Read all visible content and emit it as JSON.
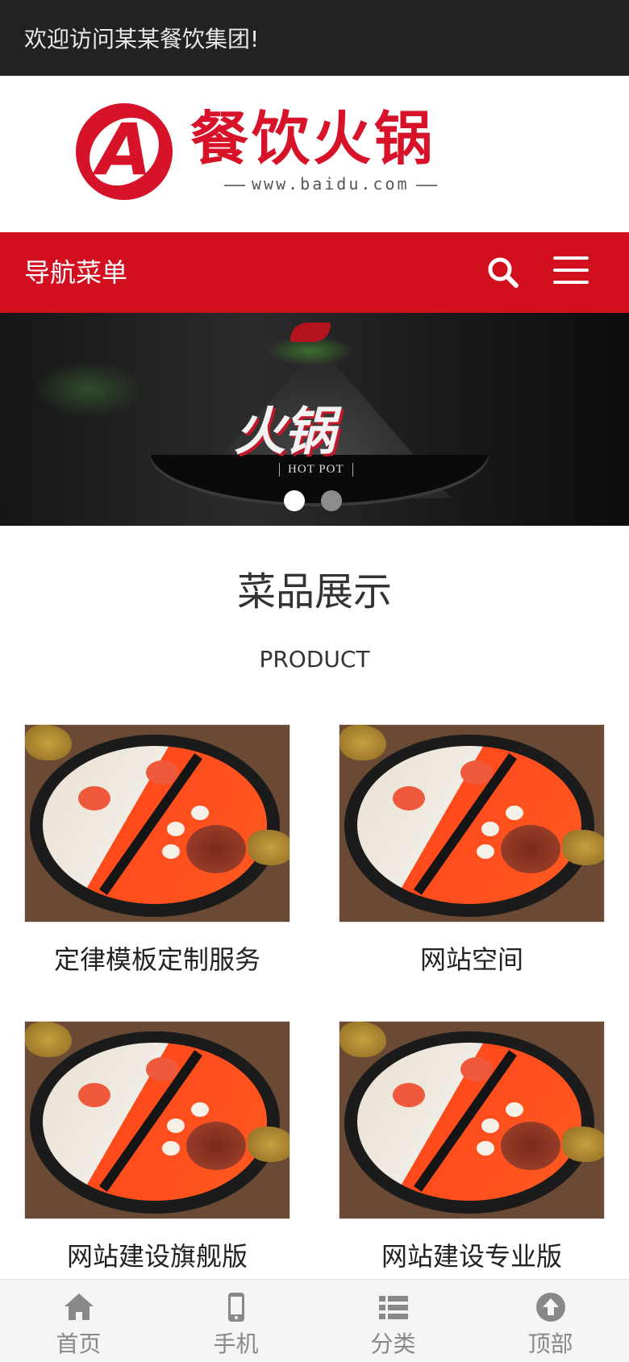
{
  "topbar": {
    "welcome": "欢迎访问某某餐饮集团!"
  },
  "logo": {
    "letter": "A",
    "title": "餐饮火锅",
    "url": "www.baidu.com",
    "brand_color": "#d7132a"
  },
  "navbar": {
    "title": "导航菜单",
    "search_icon": "search-icon",
    "menu_icon": "hamburger-menu-icon",
    "color": "#d10f1f"
  },
  "banner": {
    "brush_text": "火锅",
    "subtitle": "HOT POT",
    "slides": 2,
    "active_slide": 1
  },
  "products_section": {
    "title": "菜品展示",
    "subtitle": "PRODUCT",
    "items": [
      {
        "name": "定律模板定制服务"
      },
      {
        "name": "网站空间"
      },
      {
        "name": "网站建设旗舰版"
      },
      {
        "name": "网站建设专业版"
      }
    ]
  },
  "bottom_nav": {
    "items": [
      {
        "label": "首页",
        "icon": "home-icon"
      },
      {
        "label": "手机",
        "icon": "mobile-phone-icon"
      },
      {
        "label": "分类",
        "icon": "list-icon"
      },
      {
        "label": "顶部",
        "icon": "arrow-up-circle-icon"
      }
    ]
  }
}
